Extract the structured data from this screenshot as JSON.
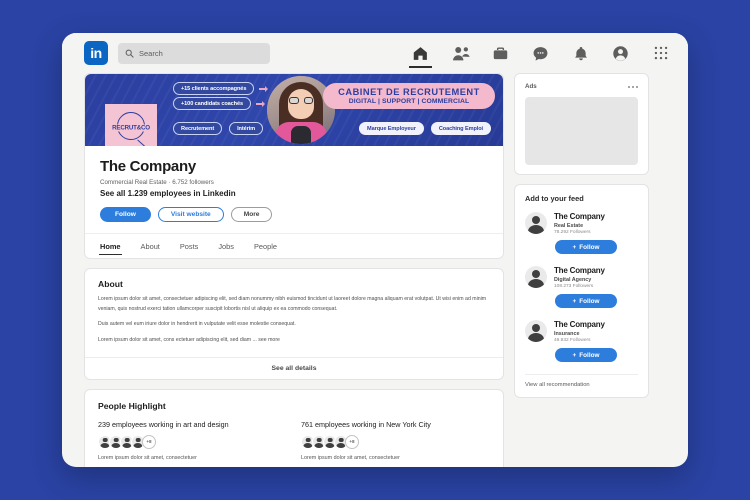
{
  "topbar": {
    "logo_text": "in",
    "search_placeholder": "Search",
    "nav": [
      {
        "name": "home-icon",
        "label": "Home",
        "active": true
      },
      {
        "name": "network-icon",
        "label": "My Network",
        "active": false
      },
      {
        "name": "jobs-icon",
        "label": "Jobs",
        "active": false
      },
      {
        "name": "messaging-icon",
        "label": "Messaging",
        "active": false
      },
      {
        "name": "notifications-icon",
        "label": "Notifications",
        "active": false
      },
      {
        "name": "profile-avatar-icon",
        "label": "Me",
        "active": false
      },
      {
        "name": "apps-grid-icon",
        "label": "Work",
        "active": false
      }
    ]
  },
  "banner": {
    "logo_label": "RECRUT&CO",
    "stat_1": "+15 clients accompagnés",
    "stat_2": "+100 candidats coachés",
    "tag_1": "Recrutement",
    "tag_2": "Intérim",
    "tag_3": "Marque Employeur",
    "tag_4": "Coaching Emploi",
    "headline": "CABINET DE RECRUTEMENT",
    "subheadline": "DIGITAL | SUPPORT | COMMERCIAL"
  },
  "company": {
    "name": "The Company",
    "meta": "Commercial Real Estate · 6.752 followers",
    "employees_link": "See all 1.239 employees in Linkedin",
    "buttons": {
      "follow": "Follow",
      "website": "Visit website",
      "more": "More"
    }
  },
  "tabs": [
    {
      "label": "Home",
      "active": true
    },
    {
      "label": "About",
      "active": false
    },
    {
      "label": "Posts",
      "active": false
    },
    {
      "label": "Jobs",
      "active": false
    },
    {
      "label": "People",
      "active": false
    }
  ],
  "about": {
    "heading": "About",
    "p1": "Lorem ipsum dolor sit amet, consectetuer adipiscing elit, sed diam nonummy nibh euismod tincidunt ut laoreet dolore magna aliquam erat volutpat. Ut wisi enim ad minim veniam, quis nostrud exerci tation ullamcorper suscipit lobortis nisl ut aliquip ex ea commodo consequat.",
    "p2": "Duis autem vel eum iriure dolor in hendrerit in vulputate velit esse molestie consequat.",
    "p3": "Lorem ipsum dolor sit amet, cons ectetuer adipiscing elit, sed diam ... see more",
    "see_all": "See all details"
  },
  "people_highlight": {
    "heading": "People Highlight",
    "columns": [
      {
        "line": "239 employees working in art and design",
        "avatar_overflow": "+8",
        "caption": "Lorem ipsum dolor sit amet, consectetuer"
      },
      {
        "line": "761 employees working in New York City",
        "avatar_overflow": "+8",
        "caption": "Lorem ipsum dolor sit amet, consectetuer"
      }
    ]
  },
  "sidebar": {
    "ads": {
      "title": "Ads"
    },
    "feed": {
      "title": "Add to your feed",
      "recommendations": [
        {
          "name": "The Company",
          "category": "Real Estate",
          "followers": "78.292 Followers",
          "follow": "Follow"
        },
        {
          "name": "The Company",
          "category": "Digital Agency",
          "followers": "108.273 Followers",
          "follow": "Follow"
        },
        {
          "name": "The Company",
          "category": "Insurance",
          "followers": "49.932 Followers",
          "follow": "Follow"
        }
      ],
      "view_all": "View all recommendation"
    }
  },
  "colors": {
    "page_background": "#2a43a4",
    "linkedin_blue": "#0a66c2",
    "accent_blue": "#2d7ddd",
    "banner_blue": "#2c3fa0",
    "banner_pink": "#f5b9cd"
  }
}
